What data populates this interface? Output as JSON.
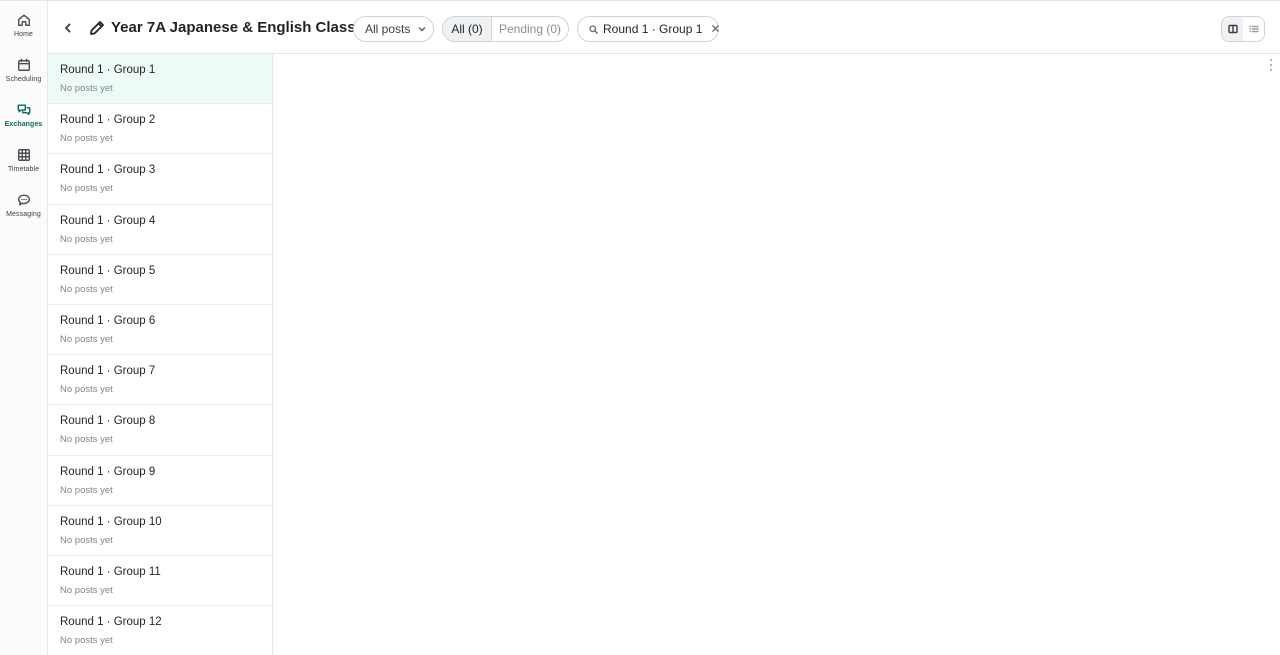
{
  "nav": {
    "items": [
      {
        "label": "Home",
        "icon": "home-icon"
      },
      {
        "label": "Scheduling",
        "icon": "calendar-icon"
      },
      {
        "label": "Exchanges",
        "icon": "chat-bubbles-icon",
        "active": true
      },
      {
        "label": "Timetable",
        "icon": "grid-icon"
      },
      {
        "label": "Messaging",
        "icon": "message-icon"
      }
    ]
  },
  "header": {
    "title": "Year 7A Japanese & English Class",
    "filter_label": "All posts",
    "seg_all": "All (0)",
    "seg_pending": "Pending (0)",
    "search_value": "Round 1 · Group 1"
  },
  "groups": [
    {
      "title": "Round 1 · Group 1",
      "subtitle": "No posts yet"
    },
    {
      "title": "Round 1 · Group 2",
      "subtitle": "No posts yet"
    },
    {
      "title": "Round 1 · Group 3",
      "subtitle": "No posts yet"
    },
    {
      "title": "Round 1 · Group 4",
      "subtitle": "No posts yet"
    },
    {
      "title": "Round 1 · Group 5",
      "subtitle": "No posts yet"
    },
    {
      "title": "Round 1 · Group 6",
      "subtitle": "No posts yet"
    },
    {
      "title": "Round 1 · Group 7",
      "subtitle": "No posts yet"
    },
    {
      "title": "Round 1 · Group 8",
      "subtitle": "No posts yet"
    },
    {
      "title": "Round 1 · Group 9",
      "subtitle": "No posts yet"
    },
    {
      "title": "Round 1 · Group 10",
      "subtitle": "No posts yet"
    },
    {
      "title": "Round 1 · Group 11",
      "subtitle": "No posts yet"
    },
    {
      "title": "Round 1 · Group 12",
      "subtitle": "No posts yet"
    }
  ],
  "colors": {
    "accent": "#0f6b5c",
    "selected_row": "#eefaf5",
    "border": "#e6e6e6"
  }
}
